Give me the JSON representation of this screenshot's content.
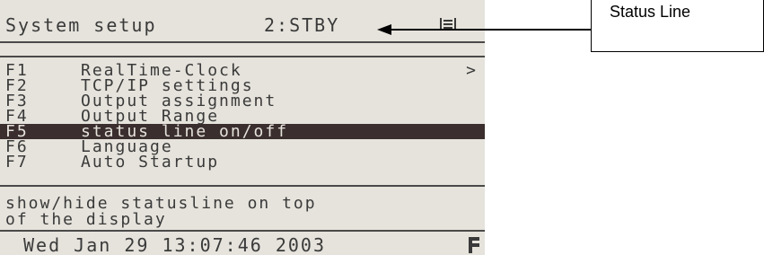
{
  "header": {
    "title": "System setup",
    "status": "2:STBY"
  },
  "menu": {
    "items": [
      {
        "key": "F1",
        "label": "RealTime-Clock"
      },
      {
        "key": "F2",
        "label": "TCP/IP settings"
      },
      {
        "key": "F3",
        "label": "Output assignment"
      },
      {
        "key": "F4",
        "label": "Output Range"
      },
      {
        "key": "F5",
        "label": "status line on/off"
      },
      {
        "key": "F6",
        "label": "Language"
      },
      {
        "key": "F7",
        "label": "Auto Startup"
      }
    ],
    "selected_index": 4,
    "more_indicator": ">"
  },
  "description": {
    "line1": "show/hide statusline on top",
    "line2": "of the display"
  },
  "footer": {
    "datetime": "Wed Jan 29 13:07:46 2003"
  },
  "annotation": {
    "label": "Status Line"
  },
  "colors": {
    "lcd_bg": "#e6e3dc",
    "lcd_fg": "#3a3a3a",
    "selection_bg": "#3a2e2e"
  },
  "icons": {
    "status_icon": "signal-bars-icon",
    "footer_icon": "f-block-icon"
  }
}
